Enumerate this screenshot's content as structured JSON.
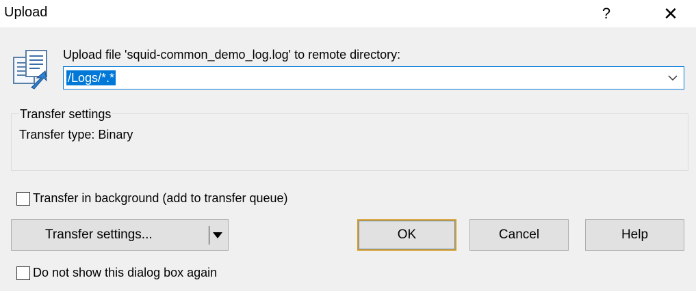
{
  "window": {
    "title": "Upload",
    "help_glyph": "?",
    "close_glyph": "✕"
  },
  "prompt": {
    "label": "Upload file 'squid-common_demo_log.log' to remote directory:",
    "icon": "upload-file-icon"
  },
  "directory": {
    "value": "/Logs/*.*",
    "dropdown_icon": "chevron-down-icon"
  },
  "transfer_group": {
    "legend": "Transfer settings",
    "transfer_type": "Transfer type: Binary"
  },
  "options": {
    "background_label": "Transfer in background (add to transfer queue)",
    "background_checked": false,
    "no_show_label": "Do not show this dialog box again",
    "no_show_checked": false
  },
  "buttons": {
    "settings_label": "Transfer settings...",
    "ok_label": "OK",
    "cancel_label": "Cancel",
    "help_label": "Help"
  },
  "colors": {
    "selection": "#0078d7",
    "focus_accent": "#d69b23",
    "client_bg": "#f0f0f0"
  }
}
